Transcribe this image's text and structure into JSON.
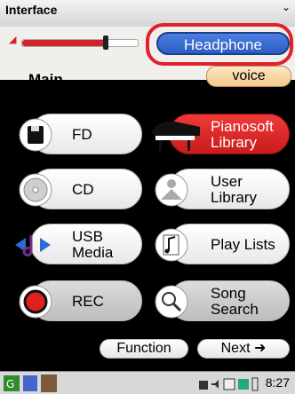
{
  "window": {
    "title": "Interface"
  },
  "volume": {
    "level": 0.72
  },
  "headphone": {
    "label": "Headphone"
  },
  "main": {
    "label": "Main",
    "voice_label": "voice"
  },
  "menu": {
    "fd": "FD",
    "pianosoft": [
      "Pianosoft",
      "Library"
    ],
    "cd": "CD",
    "user_library": [
      "User",
      "Library"
    ],
    "usb": [
      "USB",
      "Media"
    ],
    "play_lists": "Play Lists",
    "rec": "REC",
    "song_search": [
      "Song",
      "Search"
    ]
  },
  "bottom": {
    "function_label": "Function",
    "next_label": "Next"
  },
  "taskbar": {
    "time": "8:27"
  },
  "colors": {
    "accent_red": "#d2232a",
    "headphone_blue": "#3a6fd8",
    "voice_peach": "#f4c98e"
  }
}
